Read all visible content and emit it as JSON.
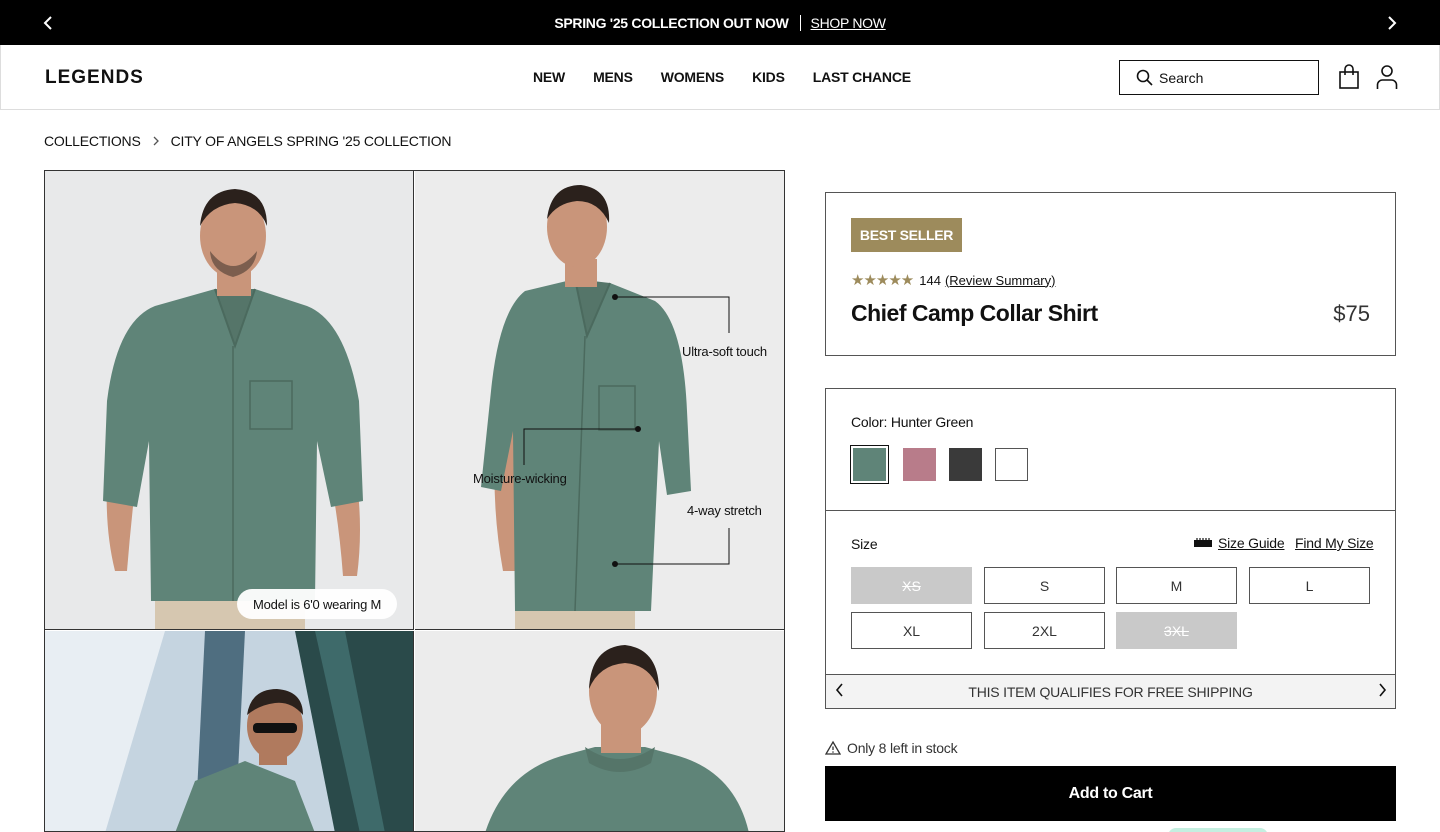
{
  "promo": {
    "message": "SPRING '25 COLLECTION OUT NOW",
    "link": "SHOP NOW"
  },
  "header": {
    "logo": "LEGENDS",
    "nav": [
      "NEW",
      "MENS",
      "WOMENS",
      "KIDS",
      "LAST CHANCE"
    ],
    "search_placeholder": "Search"
  },
  "breadcrumb": [
    "COLLECTIONS",
    "CITY OF ANGELS SPRING '25 COLLECTION"
  ],
  "gallery": {
    "model_tag": "Model is 6'0 wearing M",
    "features": [
      "Ultra-soft touch",
      "Moisture-wicking",
      "4-way stretch"
    ]
  },
  "product": {
    "badge": "BEST SELLER",
    "rating": 5,
    "review_count": "144",
    "review_link": "(Review Summary)",
    "name": "Chief Camp Collar Shirt",
    "price": "$75",
    "color_label": "Color: Hunter Green",
    "swatches": [
      "#5f8478",
      "#b87c8a",
      "#3a3a3a",
      "#ffffff"
    ],
    "size_label": "Size",
    "size_guide": "Size Guide",
    "find_my_size": "Find My Size",
    "sizes": [
      {
        "label": "XS",
        "available": false
      },
      {
        "label": "S",
        "available": true
      },
      {
        "label": "M",
        "available": true
      },
      {
        "label": "L",
        "available": true
      },
      {
        "label": "XL",
        "available": true
      },
      {
        "label": "2XL",
        "available": true
      },
      {
        "label": "3XL",
        "available": false
      }
    ],
    "shipping": "THIS ITEM QUALIFIES FOR FREE SHIPPING",
    "stock": "Only 8 left in stock",
    "add_to_cart": "Add to Cart"
  },
  "colors": {
    "badge": "#9d8b5c",
    "shirt": "#5f8478"
  }
}
